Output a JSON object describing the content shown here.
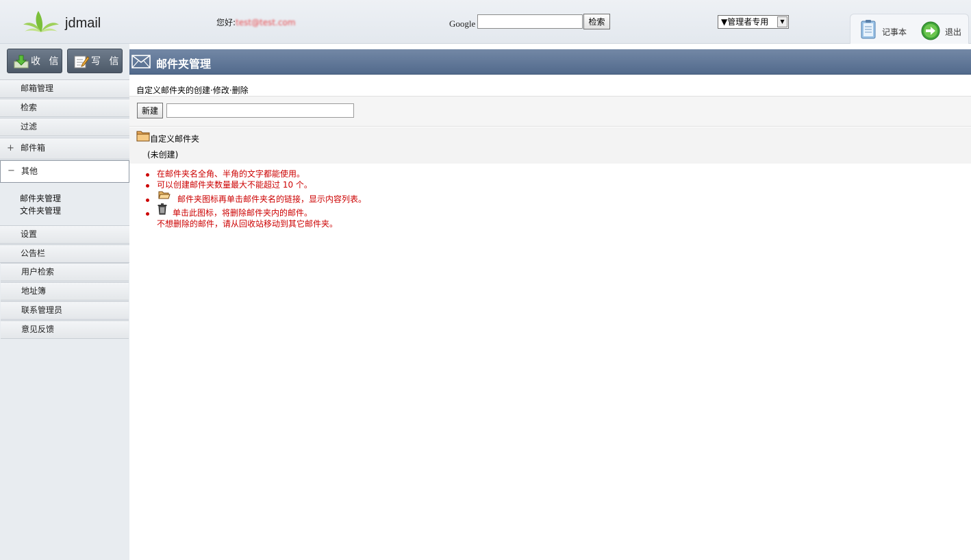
{
  "header": {
    "logo_text": "jdmail",
    "greeting_label": "您好:",
    "greeting_user": "test@test.com",
    "google_label": "Google",
    "search_value": "",
    "search_button": "检索",
    "admin_select": "▼管理者专用",
    "notepad_label": "记事本",
    "logout_label": "退出"
  },
  "sidebar": {
    "receive_label": "收 信",
    "compose_label": "写 信",
    "items": [
      {
        "label": "邮箱管理"
      },
      {
        "label": "检索"
      },
      {
        "label": "过滤"
      },
      {
        "label": "邮件箱",
        "sign": "+"
      },
      {
        "label": "其他",
        "sign": "−"
      },
      {
        "label": "设置"
      },
      {
        "label": "公告栏"
      },
      {
        "label": "用户检索"
      },
      {
        "label": "地址簿"
      },
      {
        "label": "联系管理员"
      },
      {
        "label": "意见反馈"
      }
    ],
    "sub_items": [
      {
        "label": "邮件夹管理"
      },
      {
        "label": "文件夹管理"
      }
    ]
  },
  "main": {
    "title": "邮件夹管理",
    "description": "自定义邮件夹的创建·修改·删除",
    "new_button": "新建",
    "new_input_value": "",
    "folder_section_title": "自定义邮件夹",
    "folder_empty_text": "(未创建)",
    "notes": [
      "在邮件夹名全角、半角的文字都能使用。",
      "可以创建邮件夹数量最大不能超过 10 个。",
      "邮件夹图标再单击邮件夹名的链接，显示内容列表。",
      "单击此图标，将删除邮件夹内的邮件。",
      "不想删除的邮件，请从回收站移动到其它邮件夹。"
    ]
  },
  "colors": {
    "title_bar": "#5f7597",
    "note_text": "#cc0000",
    "sidebar_bg": "#e8ecf0"
  }
}
